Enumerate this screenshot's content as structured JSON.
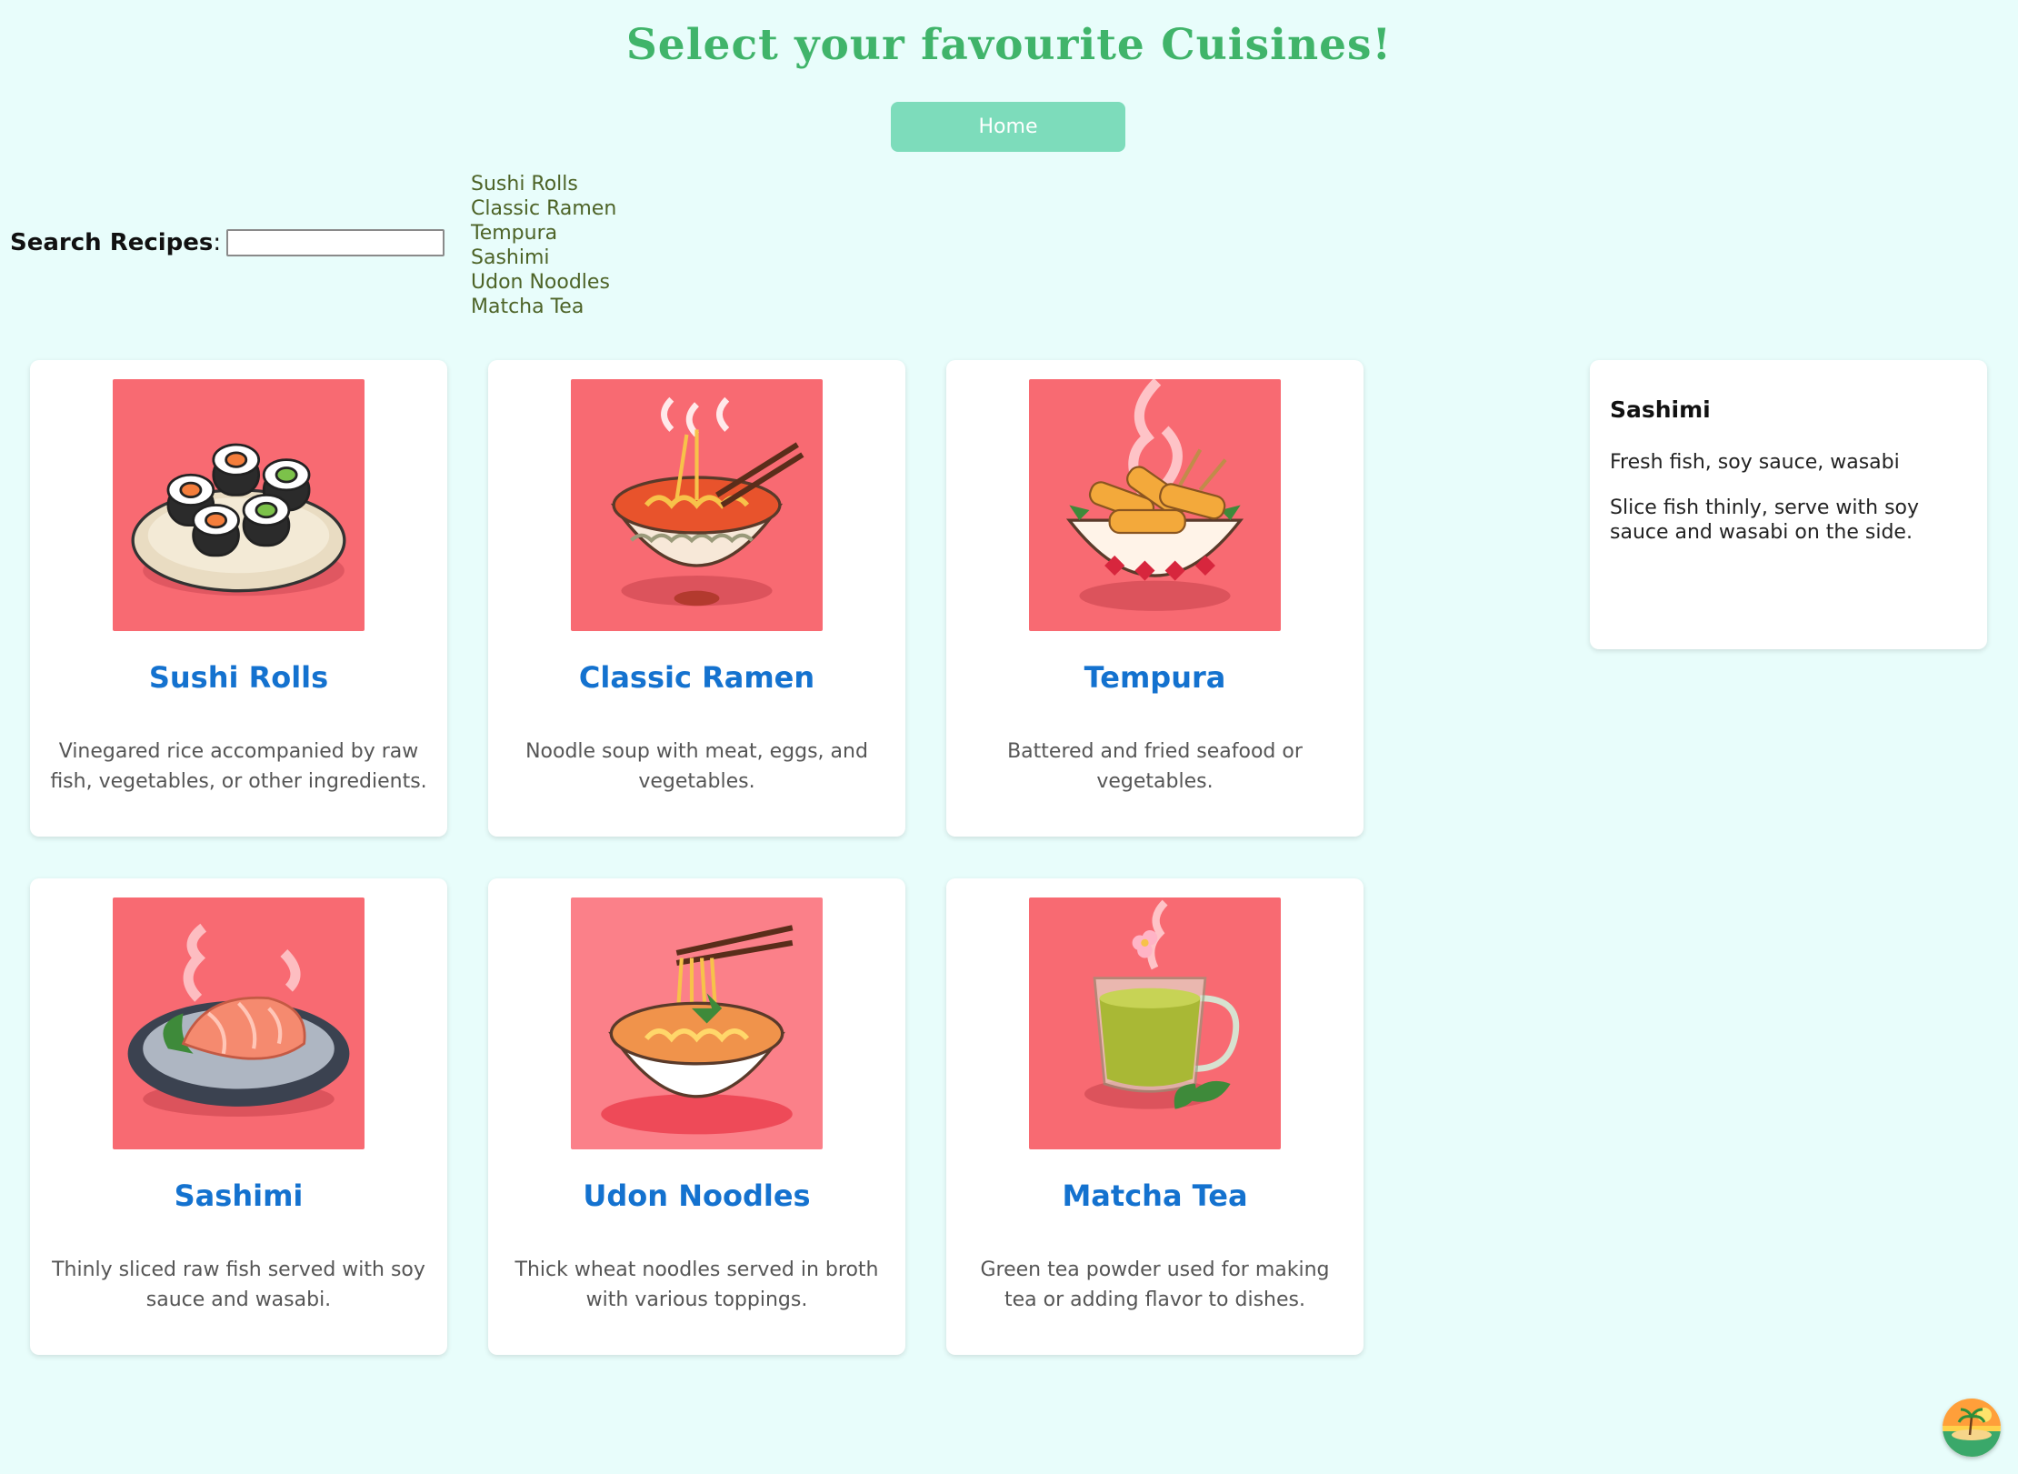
{
  "header": {
    "title": "Select your favourite Cuisines!",
    "home_label": "Home"
  },
  "search": {
    "label": "Search Recipes",
    "colon": ":",
    "value": "",
    "placeholder": "",
    "suggestions": [
      "Sushi Rolls",
      "Classic Ramen",
      "Tempura",
      "Sashimi",
      "Udon Noodles",
      "Matcha Tea"
    ]
  },
  "cards": [
    {
      "name": "Sushi Rolls",
      "desc": "Vinegared rice accompanied by raw fish, vegetables, or other ingredients.",
      "icon": "sushi-rolls-image"
    },
    {
      "name": "Classic Ramen",
      "desc": "Noodle soup with meat, eggs, and vegetables.",
      "icon": "ramen-bowl-image"
    },
    {
      "name": "Tempura",
      "desc": "Battered and fried seafood or vegetables.",
      "icon": "tempura-bowl-image"
    },
    {
      "name": "Sashimi",
      "desc": "Thinly sliced raw fish served with soy sauce and wasabi.",
      "icon": "sashimi-plate-image"
    },
    {
      "name": "Udon Noodles",
      "desc": "Thick wheat noodles served in broth with various toppings.",
      "icon": "udon-bowl-image"
    },
    {
      "name": "Matcha Tea",
      "desc": "Green tea powder used for making tea or adding flavor to dishes.",
      "icon": "matcha-cup-image"
    }
  ],
  "detail": {
    "title": "Sashimi",
    "ingredients": "Fresh fish, soy sauce, wasabi",
    "steps": "Slice fish thinly, serve with soy sauce and wasabi on the side."
  },
  "colors": {
    "background": "#e8fdfb",
    "title": "#40b46a",
    "button": "#7ddcbb",
    "card_title": "#1472cf",
    "image_bg": "#f86a72"
  }
}
